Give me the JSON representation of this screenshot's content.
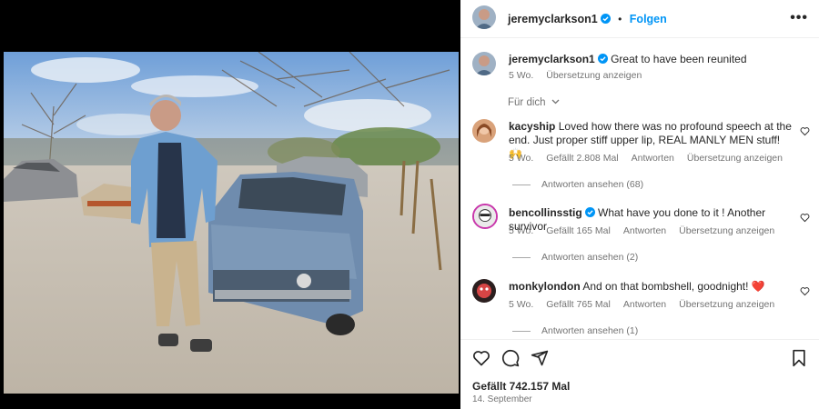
{
  "post": {
    "author": "jeremyclarkson1",
    "follow_label": "Folgen",
    "caption": "Great to have been reunited",
    "caption_age": "5 Wo.",
    "caption_translate": "Übersetzung anzeigen",
    "for_you_label": "Für dich",
    "likes_label": "Gefällt 742.157 Mal",
    "date": "14. September"
  },
  "comments": [
    {
      "user": "kacyship",
      "text": "Loved how there was no profound speech at the end. Just proper stiff upper lip, REAL MANLY MEN stuff! 🙌",
      "age": "5 Wo.",
      "likes": "Gefällt 2.808 Mal",
      "reply": "Antworten",
      "translate": "Übersetzung anzeigen",
      "view_replies": "Antworten ansehen (68)"
    },
    {
      "user": "bencollinsstig",
      "text": "What have you done to it ! Another survivor",
      "age": "5 Wo.",
      "likes": "Gefällt 165 Mal",
      "reply": "Antworten",
      "translate": "Übersetzung anzeigen",
      "view_replies": "Antworten ansehen (2)"
    },
    {
      "user": "monkylondon",
      "text": "And on that bombshell, goodnight! ❤️",
      "age": "5 Wo.",
      "likes": "Gefällt 765 Mal",
      "reply": "Antworten",
      "translate": "Übersetzung anzeigen",
      "view_replies": "Antworten ansehen (1)"
    }
  ],
  "icons": {
    "verified": "verified-badge-icon",
    "more": "more-options-icon",
    "like": "heart-icon",
    "comment": "comment-icon",
    "share": "share-icon",
    "save": "bookmark-icon",
    "chevron": "chevron-down-icon"
  },
  "colors": {
    "accent": "#0095f6",
    "secondary_text": "#737373",
    "heart_red": "#ed4956"
  }
}
